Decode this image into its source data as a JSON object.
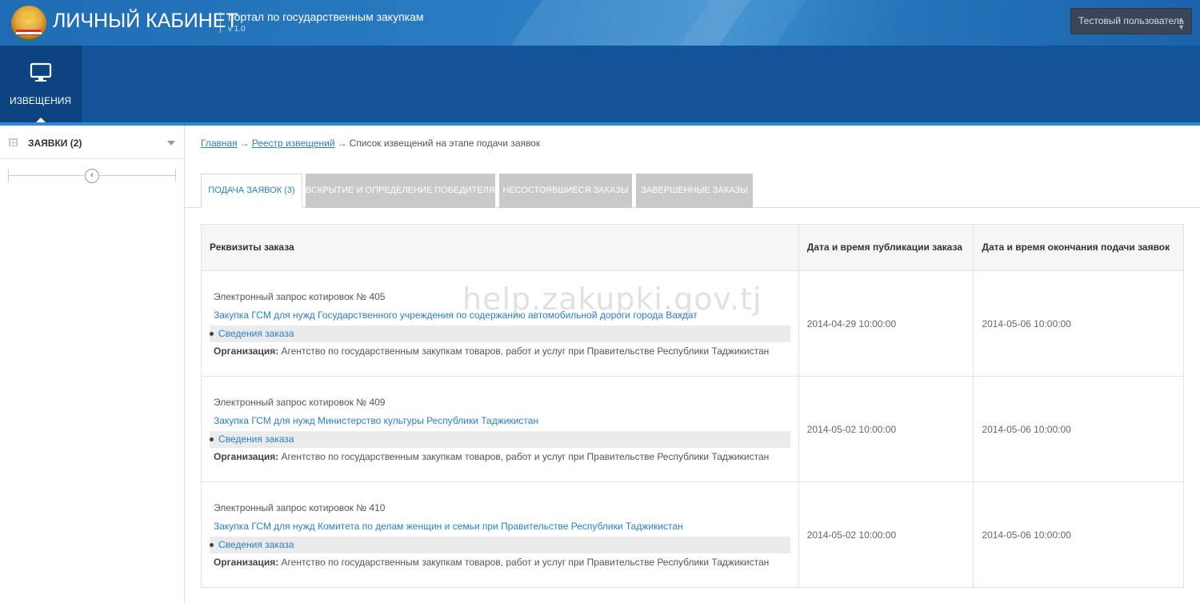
{
  "header": {
    "brand": "ЛИЧНЫЙ КАБИНЕТ",
    "portal": "портал по государственным закупкам",
    "version": "v 1.0",
    "user": "Тестовый пользователь"
  },
  "nav": {
    "items": [
      {
        "label": "ИЗВЕЩЕНИЯ",
        "icon": "monitor-icon",
        "active": true
      }
    ]
  },
  "sidebar": {
    "title": "ЗАЯВКИ (2)"
  },
  "breadcrumb": {
    "home": "Главная",
    "registry": "Реестр извещений",
    "current": "Список извещений на этапе подачи заявок",
    "separator": "→"
  },
  "tabs": [
    {
      "label": "ПОДАЧА ЗАЯВОК (3)",
      "active": true
    },
    {
      "label": "ВСКРЫТИЕ И ОПРЕДЕЛЕНИЕ ПОБЕДИТЕЛЯ",
      "active": false
    },
    {
      "label": "НЕСОСТОЯВШИЕСЯ ЗАКАЗЫ",
      "active": false
    },
    {
      "label": "ЗАВЕРШЕННЫЕ ЗАКАЗЫ",
      "active": false
    }
  ],
  "table": {
    "headers": [
      "Реквизиты заказа",
      "Дата и время публикации заказа",
      "Дата и время окончания подачи заявок"
    ],
    "rows": [
      {
        "number": "Электронный запрос котировок № 405",
        "subject": "Закупка ГСМ для нужд Государственного учреждения по содержанию автомобильной дороги города Вахдат",
        "details": "Сведения заказа",
        "org_label": "Организация:",
        "org": "Агентство по государственным закупкам товаров, работ и услуг при Правительстве Республики Таджикистан",
        "published": "2014-04-29 10:00:00",
        "deadline": "2014-05-06 10:00:00"
      },
      {
        "number": "Электронный запрос котировок № 409",
        "subject": "Закупка ГСМ для нужд Министерство культуры Республики Таджикистан",
        "details": "Сведения заказа",
        "org_label": "Организация:",
        "org": "Агентство по государственным закупкам товаров, работ и услуг при Правительстве Республики Таджикистан",
        "published": "2014-05-02 10:00:00",
        "deadline": "2014-05-06 10:00:00"
      },
      {
        "number": "Электронный запрос котировок № 410",
        "subject": "Закупка ГСМ для нужд Комитета по делам женщин и семьи при Правительстве Республики Таджикистан",
        "details": "Сведения заказа",
        "org_label": "Организация:",
        "org": "Агентство по государственным закупкам товаров, работ и услуг при Правительстве Республики Таджикистан",
        "published": "2014-05-02 10:00:00",
        "deadline": "2014-05-06 10:00:00"
      }
    ]
  },
  "watermark": "help.zakupki.gov.tj",
  "colors": {
    "header_blue": "#1f6cb3",
    "nav_blue": "#135399",
    "nav_active": "#0b4480",
    "link": "#2a7fc9",
    "tab_inactive": "#c9c9c9"
  }
}
